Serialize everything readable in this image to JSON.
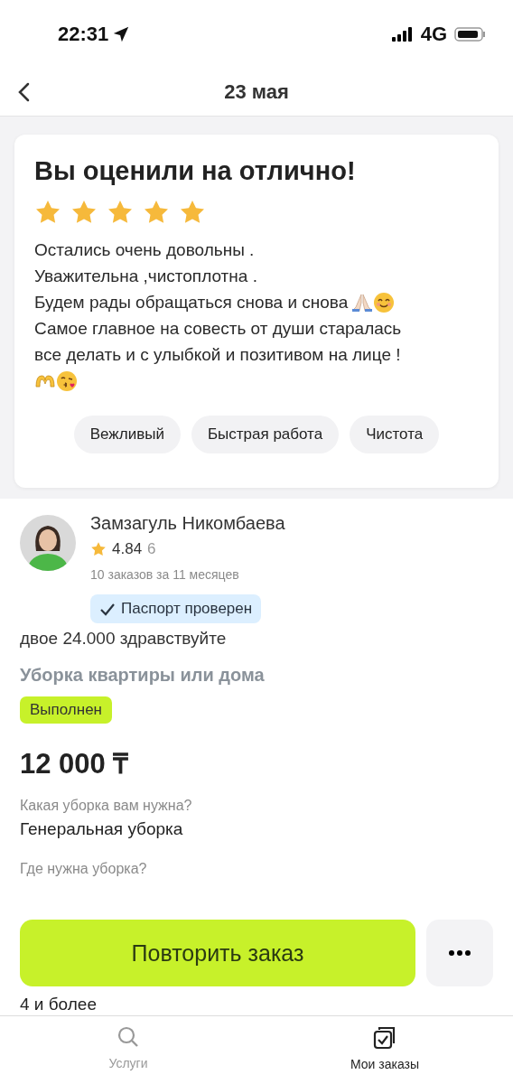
{
  "status_bar": {
    "time": "22:31",
    "network": "4G"
  },
  "header": {
    "title": "23 мая"
  },
  "review": {
    "title": "Вы оценили на отлично!",
    "stars": 5,
    "lines": [
      "Остались очень довольны .",
      "Уважительна ,чистоплотна .",
      "Будем рады обращаться снова и снова",
      "Самое главное на совесть от души старалась",
      "все делать и с улыбкой и позитивом на лице !"
    ],
    "tags": [
      "Вежливый",
      "Быстрая работа",
      "Чистота"
    ]
  },
  "performer": {
    "name": "Замзагуль Никомбаева",
    "rating": "4.84",
    "reviews": "6",
    "orders": "10 заказов за 11 месяцев",
    "badge": "Паспорт проверен"
  },
  "comment": "двое 24.000 здравствуйте",
  "order": {
    "service": "Уборка квартиры или дома",
    "status": "Выполнен",
    "price": "12 000 ₸",
    "fields": [
      {
        "label": "Какая уборка вам нужна?",
        "value": "Генеральная уборка"
      },
      {
        "label": "Где нужна уборка?"
      },
      {
        "value": "4 и более"
      }
    ]
  },
  "actions": {
    "primary": "Повторить заказ"
  },
  "tabs": [
    {
      "label": "Услуги",
      "selected": false
    },
    {
      "label": "Мои заказы",
      "selected": true
    }
  ]
}
